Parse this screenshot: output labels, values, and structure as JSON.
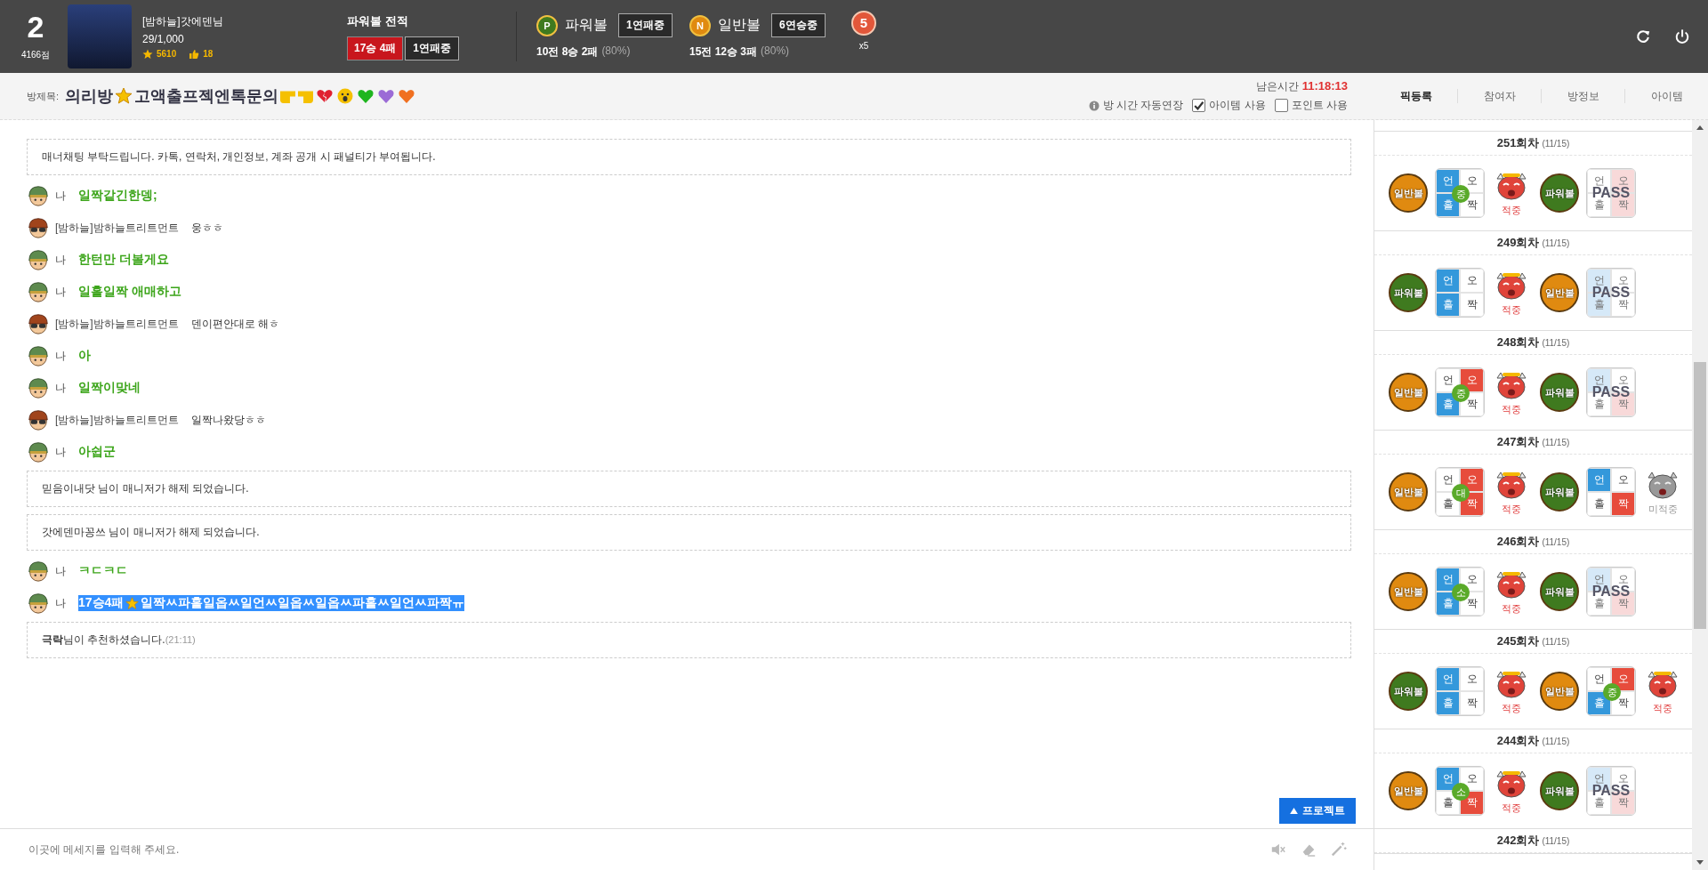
{
  "header": {
    "rank": "2",
    "score": "4166점",
    "user": {
      "name": "[밤하늘]갓에덴님",
      "progress": "29/1,000",
      "points": "5610",
      "likes": "18"
    },
    "record": {
      "title": "파워볼 전적",
      "wins": "17승 4패",
      "streak": "1연패중"
    },
    "balls": [
      {
        "kind": "power",
        "letter": "P",
        "name": "파워볼",
        "streak": "1연패중",
        "record": "10전 8승 2패",
        "rate": "(80%)"
      },
      {
        "kind": "normal",
        "letter": "N",
        "name": "일반볼",
        "streak": "6연승중",
        "record": "15전 12승 3패",
        "rate": "(80%)"
      }
    ],
    "medal": {
      "number": "5",
      "count": "x5"
    }
  },
  "room": {
    "label": "방제목:",
    "title_segments": [
      "의리방",
      "고액출프젝엔톡문의"
    ],
    "time_label": "남은시간",
    "time": "11:18:13",
    "options": [
      {
        "kind": "info",
        "label": "방 시간 자동연장"
      },
      {
        "kind": "checkbox",
        "label": "아이템 사용",
        "checked": true
      },
      {
        "kind": "checkbox",
        "label": "포인트 사용",
        "checked": false
      }
    ]
  },
  "tabs": [
    {
      "label": "픽등록",
      "selected": true
    },
    {
      "label": "참여자",
      "selected": false
    },
    {
      "label": "방정보",
      "selected": false
    },
    {
      "label": "아이템",
      "selected": false
    }
  ],
  "chat": {
    "messages": [
      {
        "kind": "notice",
        "text": "매너채팅 부탁드립니다. 카톡, 연락처, 개인정보, 계좌 공개 시 패널티가 부여됩니다."
      },
      {
        "kind": "mine",
        "name": "나",
        "segments": [
          "일짝같긴한뎅;"
        ],
        "highlighted": false
      },
      {
        "kind": "other",
        "name": "[밤하늘]밤하늘트리트먼트",
        "segments": [
          "웅ㅎㅎ"
        ]
      },
      {
        "kind": "mine",
        "name": "나",
        "segments": [
          "한턴만 더볼게요"
        ],
        "highlighted": false
      },
      {
        "kind": "mine",
        "name": "나",
        "segments": [
          "일홀일짝 애매하고"
        ],
        "highlighted": false
      },
      {
        "kind": "other",
        "name": "[밤하늘]밤하늘트리트먼트",
        "segments": [
          "덴이편안대로 해ㅎ"
        ]
      },
      {
        "kind": "mine",
        "name": "나",
        "segments": [
          "아"
        ],
        "highlighted": false
      },
      {
        "kind": "mine",
        "name": "나",
        "segments": [
          "일짝이맞네"
        ],
        "highlighted": false
      },
      {
        "kind": "other",
        "name": "[밤하늘]밤하늘트리트먼트",
        "segments": [
          "일짝나왔당ㅎㅎ"
        ]
      },
      {
        "kind": "mine",
        "name": "나",
        "segments": [
          "아쉽군"
        ],
        "highlighted": false
      },
      {
        "kind": "notice",
        "text": "믿음이내닷 님이 매니저가 해제 되었습니다."
      },
      {
        "kind": "notice",
        "text": "갓에덴마꽁쓰 님이 매니저가 해제 되었습니다."
      },
      {
        "kind": "mine",
        "name": "나",
        "segments": [
          "ㅋㄷㅋㄷ"
        ],
        "highlighted": false
      },
      {
        "kind": "mine",
        "name": "나",
        "segments": [
          "17승4패",
          "일짝ㅆ파홀일옵ㅆ일언ㅆ일옵ㅆ일옵ㅆ파홀ㅆ일언ㅆ파짝ㅠ"
        ],
        "highlighted": true
      },
      {
        "kind": "notice",
        "text": "**극락**님이 추천하셨습니다.",
        "time": "(21:11)"
      }
    ],
    "project_button": "프로젝트",
    "input": {
      "placeholder": "이곳에 메세지를 입력해 주세요."
    }
  },
  "rounds": [
    {
      "title": "251회차",
      "date": "(11/15)",
      "picks": [
        {
          "ball": "일반볼",
          "color": "#e08a10",
          "cells": [
            {
              "label": "언",
              "on": true
            },
            {
              "label": "오",
              "on": false
            },
            {
              "label": "홀",
              "on": true
            },
            {
              "label": "짝",
              "on": false
            }
          ],
          "badge": "중",
          "result": "적중",
          "hit": true
        },
        {
          "ball": "파워볼",
          "color": "#3f7a1f",
          "cells": [
            {
              "label": "언",
              "on": false
            },
            {
              "label": "오",
              "on": true
            },
            {
              "label": "홀",
              "on": false
            },
            {
              "label": "짝",
              "on": true
            }
          ],
          "pass": "PASS"
        }
      ]
    },
    {
      "title": "249회차",
      "date": "(11/15)",
      "picks": [
        {
          "ball": "파워볼",
          "color": "#3f7a1f",
          "cells": [
            {
              "label": "언",
              "on": true
            },
            {
              "label": "오",
              "on": false
            },
            {
              "label": "홀",
              "on": true
            },
            {
              "label": "짝",
              "on": false
            }
          ],
          "result": "적중",
          "hit": true
        },
        {
          "ball": "일반볼",
          "color": "#e08a10",
          "cells": [
            {
              "label": "언",
              "on": true
            },
            {
              "label": "오",
              "on": false
            },
            {
              "label": "홀",
              "on": true
            },
            {
              "label": "짝",
              "on": false
            }
          ],
          "pass": "PASS"
        }
      ]
    },
    {
      "title": "248회차",
      "date": "(11/15)",
      "picks": [
        {
          "ball": "일반볼",
          "color": "#e08a10",
          "cells": [
            {
              "label": "언",
              "on": false
            },
            {
              "label": "오",
              "on": true
            },
            {
              "label": "홀",
              "on": true
            },
            {
              "label": "짝",
              "on": false
            }
          ],
          "badge": "중",
          "result": "적중",
          "hit": true
        },
        {
          "ball": "파워볼",
          "color": "#3f7a1f",
          "cells": [
            {
              "label": "언",
              "on": true
            },
            {
              "label": "오",
              "on": false
            },
            {
              "label": "홀",
              "on": false
            },
            {
              "label": "짝",
              "on": true
            }
          ],
          "pass": "PASS"
        }
      ]
    },
    {
      "title": "247회차",
      "date": "(11/15)",
      "picks": [
        {
          "ball": "일반볼",
          "color": "#e08a10",
          "cells": [
            {
              "label": "언",
              "on": false
            },
            {
              "label": "오",
              "on": true
            },
            {
              "label": "홀",
              "on": false
            },
            {
              "label": "짝",
              "on": true
            }
          ],
          "badge": "대",
          "result": "적중",
          "hit": true
        },
        {
          "ball": "파워볼",
          "color": "#3f7a1f",
          "cells": [
            {
              "label": "언",
              "on": true
            },
            {
              "label": "오",
              "on": false
            },
            {
              "label": "홀",
              "on": false
            },
            {
              "label": "짝",
              "on": true
            }
          ],
          "result": "미적중",
          "hit": false
        }
      ]
    },
    {
      "title": "246회차",
      "date": "(11/15)",
      "picks": [
        {
          "ball": "일반볼",
          "color": "#e08a10",
          "cells": [
            {
              "label": "언",
              "on": true
            },
            {
              "label": "오",
              "on": false
            },
            {
              "label": "홀",
              "on": true
            },
            {
              "label": "짝",
              "on": false
            }
          ],
          "badge": "소",
          "result": "적중",
          "hit": true
        },
        {
          "ball": "파워볼",
          "color": "#3f7a1f",
          "cells": [
            {
              "label": "언",
              "on": true
            },
            {
              "label": "오",
              "on": false
            },
            {
              "label": "홀",
              "on": false
            },
            {
              "label": "짝",
              "on": true
            }
          ],
          "pass": "PASS"
        }
      ]
    },
    {
      "title": "245회차",
      "date": "(11/15)",
      "picks": [
        {
          "ball": "파워볼",
          "color": "#3f7a1f",
          "cells": [
            {
              "label": "언",
              "on": true
            },
            {
              "label": "오",
              "on": false
            },
            {
              "label": "홀",
              "on": true
            },
            {
              "label": "짝",
              "on": false
            }
          ],
          "result": "적중",
          "hit": true
        },
        {
          "ball": "일반볼",
          "color": "#e08a10",
          "cells": [
            {
              "label": "언",
              "on": false
            },
            {
              "label": "오",
              "on": true
            },
            {
              "label": "홀",
              "on": true
            },
            {
              "label": "짝",
              "on": false
            }
          ],
          "badge": "중",
          "result": "적중",
          "hit": true
        }
      ]
    },
    {
      "title": "244회차",
      "date": "(11/15)",
      "picks": [
        {
          "ball": "일반볼",
          "color": "#e08a10",
          "cells": [
            {
              "label": "언",
              "on": true
            },
            {
              "label": "오",
              "on": false
            },
            {
              "label": "홀",
              "on": false
            },
            {
              "label": "짝",
              "on": true
            }
          ],
          "badge": "소",
          "result": "적중",
          "hit": true
        },
        {
          "ball": "파워볼",
          "color": "#3f7a1f",
          "cells": [
            {
              "label": "언",
              "on": true
            },
            {
              "label": "오",
              "on": false
            },
            {
              "label": "홀",
              "on": false
            },
            {
              "label": "짝",
              "on": true
            }
          ],
          "pass": "PASS"
        }
      ]
    },
    {
      "title": "242회차",
      "date": "(11/15)"
    }
  ]
}
